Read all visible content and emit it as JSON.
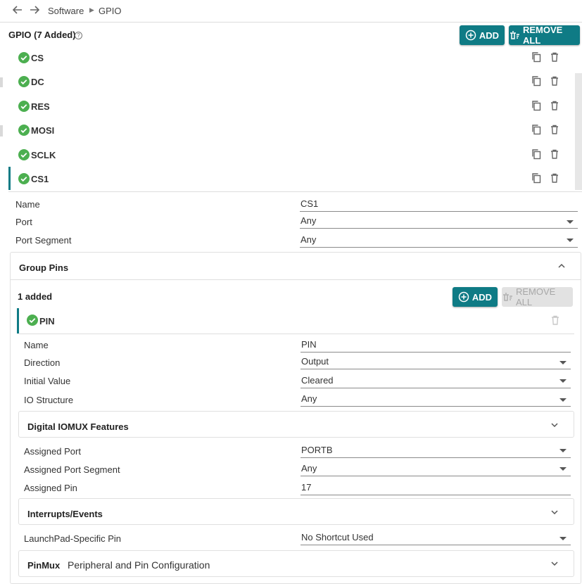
{
  "breadcrumb": {
    "back_icon": "arrow-left-icon",
    "forward_icon": "arrow-right-icon",
    "items": [
      "Software",
      "GPIO"
    ]
  },
  "gpio": {
    "title": "GPIO (7 Added)",
    "add_label": "ADD",
    "remove_all_label": "REMOVE ALL",
    "items": [
      {
        "label": "CS"
      },
      {
        "label": "DC"
      },
      {
        "label": "RES"
      },
      {
        "label": "MOSI"
      },
      {
        "label": "SCLK"
      },
      {
        "label": "CS1"
      }
    ],
    "selected": "CS1"
  },
  "props": {
    "name_label": "Name",
    "name_value": "CS1",
    "port_label": "Port",
    "port_value": "Any",
    "segment_label": "Port Segment",
    "segment_value": "Any"
  },
  "group_pins": {
    "title": "Group Pins",
    "count": "1 added",
    "add_label": "ADD",
    "remove_all_label": "REMOVE ALL",
    "pin_label": "PIN",
    "pin_props": {
      "name_label": "Name",
      "name_value": "PIN",
      "direction_label": "Direction",
      "direction_value": "Output",
      "initial_label": "Initial Value",
      "initial_value": "Cleared",
      "io_label": "IO Structure",
      "io_value": "Any"
    },
    "iomux": {
      "title": "Digital IOMUX Features",
      "assigned_port_label": "Assigned Port",
      "assigned_port_value": "PORTB",
      "assigned_segment_label": "Assigned Port Segment",
      "assigned_segment_value": "Any",
      "assigned_pin_label": "Assigned Pin",
      "assigned_pin_value": "17"
    },
    "interrupts_title": "Interrupts/Events",
    "launchpad_label": "LaunchPad-Specific Pin",
    "launchpad_value": "No Shortcut Used",
    "pinmux_title": "PinMux",
    "pinmux_subtitle": "Peripheral and Pin Configuration"
  },
  "colors": {
    "accent": "#0f7b85",
    "check_green": "#4caf50",
    "disabled": "#e2e2e2"
  }
}
